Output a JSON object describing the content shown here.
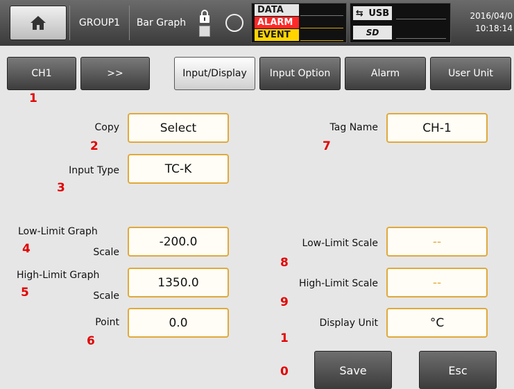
{
  "topbar": {
    "home_icon": "home-icon",
    "group": "GROUP1",
    "view": "Bar Graph",
    "lock_icon": "lock-icon",
    "record_icon": "circle-icon",
    "status": {
      "data_label": "DATA",
      "alarm_label": "ALARM",
      "event_label": "EVENT",
      "data_color": "#ffffff",
      "alarm_color": "#ff2a2a",
      "event_color": "#ffd400"
    },
    "usb_label": "USB",
    "usb_icon": "usb-icon",
    "sd_icon": "sd-card-icon",
    "sd_label": "SD",
    "date": "2016/04/0",
    "time": "10:18:14"
  },
  "nav": {
    "channel": "CH1",
    "next": ">>",
    "tabs": [
      "Input/Display",
      "Input Option",
      "Alarm",
      "User Unit"
    ],
    "active_tab": "Input/Display"
  },
  "form": {
    "copy_label": "Copy",
    "copy_value": "Select",
    "input_type_label": "Input Type",
    "input_type_value": "TC-K",
    "low_graph_label_1": "Low-Limit Graph",
    "low_graph_label_2": "Scale",
    "low_graph_value": "-200.0",
    "high_graph_label_1": "High-Limit Graph",
    "high_graph_label_2": "Scale",
    "high_graph_value": "1350.0",
    "point_label": "Point",
    "point_value": "0.0",
    "tag_label": "Tag Name",
    "tag_value": "CH-1",
    "low_scale_label": "Low-Limit Scale",
    "low_scale_value": "--",
    "high_scale_label": "High-Limit Scale",
    "high_scale_value": "--",
    "unit_label": "Display Unit",
    "unit_value": "°C"
  },
  "actions": {
    "save": "Save",
    "esc": "Esc"
  },
  "annotations": {
    "n1": "1",
    "n2": "2",
    "n3": "3",
    "n4": "4",
    "n5": "5",
    "n6": "6",
    "n7": "7",
    "n8": "8",
    "n9": "9",
    "n10a": "1",
    "n10b": "0"
  }
}
